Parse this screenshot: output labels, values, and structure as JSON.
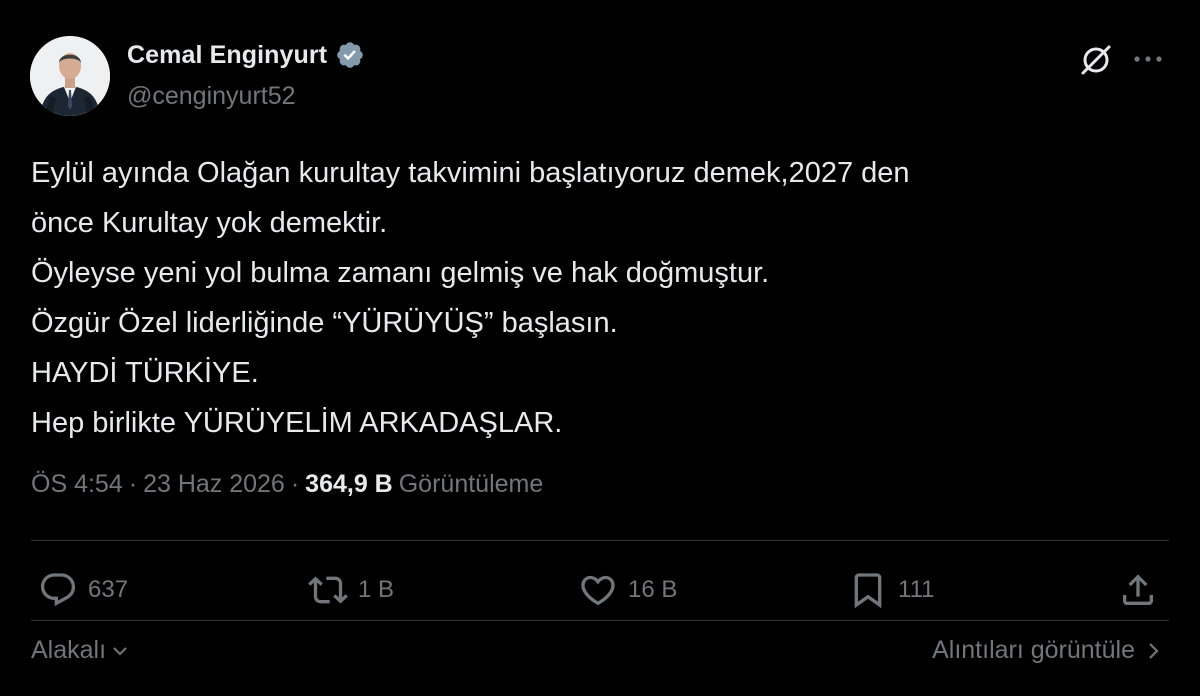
{
  "author": {
    "name": "Cemal Enginyurt",
    "handle": "@cenginyurt52",
    "verified": true
  },
  "tweet": {
    "lines": [
      "Eylül ayında Olağan kurultay takvimini başlatıyoruz demek,2027 den",
      "önce Kurultay yok demektir.",
      "Öyleyse yeni yol bulma zamanı gelmiş ve hak doğmuştur.",
      "Özgür Özel liderliğinde “YÜRÜYÜŞ” başlasın.",
      "HAYDİ TÜRKİYE.",
      "Hep birlikte YÜRÜYELİM ARKADAŞLAR."
    ]
  },
  "meta": {
    "time": "ÖS 4:54",
    "separator": "·",
    "date": "23 Haz 2026",
    "views_count": "364,9 B",
    "views_label": "Görüntüleme"
  },
  "actions": {
    "reply_count": "637",
    "retweet_count": "1 B",
    "like_count": "16 B",
    "bookmark_count": "111"
  },
  "footer": {
    "sort_label": "Alakalı",
    "quotes_label": "Alıntıları görüntüle"
  },
  "colors": {
    "background": "#000000",
    "text_primary": "#e7e9ea",
    "text_secondary": "#71767b",
    "verified": "#829aab",
    "divider": "#2f3336"
  },
  "icons": [
    "verified-badge-icon",
    "grok-icon",
    "more-icon",
    "reply-icon",
    "retweet-icon",
    "like-icon",
    "bookmark-icon",
    "share-icon",
    "chevron-down-icon",
    "chevron-right-icon"
  ]
}
